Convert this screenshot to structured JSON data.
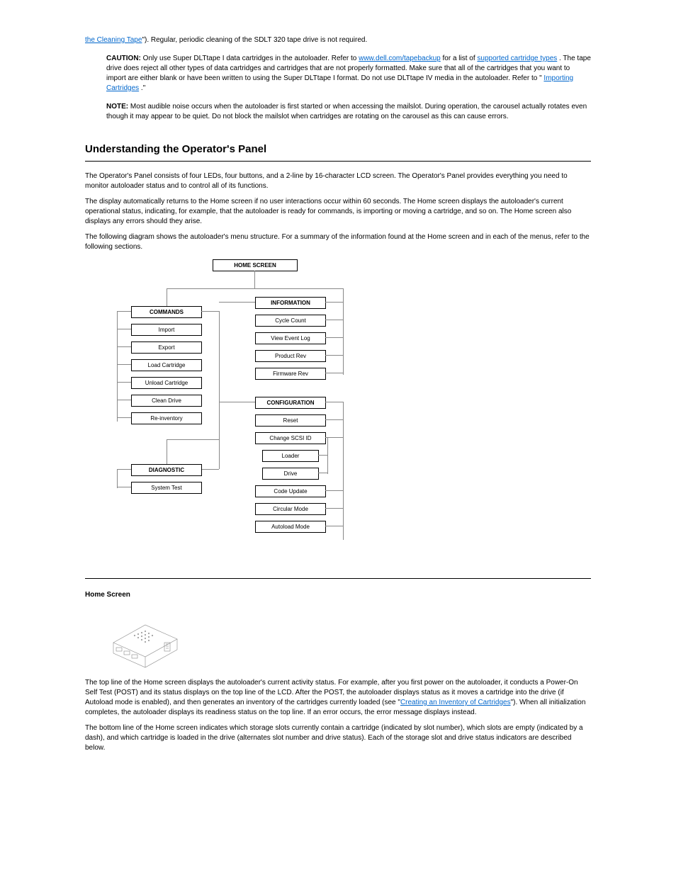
{
  "intro": {
    "line1_pre": "the Cleaning Tape",
    "line1_post": "\"). Regular, periodic cleaning of the SDLT 320 tape drive is not required."
  },
  "caution": {
    "label": "CAUTION:",
    "text_pre": "Only use Super DLTtape I data cartridges in the autoloader. Refer to ",
    "link1": "www.dell.com/tapebackup",
    "mid1": " for a list of ",
    "link2": "supported cartridge types",
    "mid2": ". The tape drive does reject all other types of data cartridges and cartridges that are not properly formatted. Make sure that all of the cartridges that you want to import are either blank or have been written to using the Super DLTtape I format. Do not use DLTtape IV media in the autoloader. Refer to \"",
    "link3": "Importing Cartridges",
    "close": ".\""
  },
  "note": {
    "label": "NOTE:",
    "text": "Most audible noise occurs when the autoloader is first started or when accessing the mailslot. During operation, the carousel actually rotates even though it may appear to be quiet. Do not block the mailslot when cartridges are rotating on the carousel as this can cause errors."
  },
  "h1": "Understanding the Operator's Panel",
  "op_p1": "The Operator's Panel consists of four LEDs, four buttons, and a 2-line by 16-character LCD screen. The Operator's Panel provides everything you need to monitor autoloader status and to control all of its functions.",
  "op_p2": "The display automatically returns to the Home screen if no user interactions occur within 60 seconds. The Home screen displays the autoloader's current operational status, indicating, for example, that the autoloader is ready for commands, is importing or moving a cartridge, and so on. The Home screen also displays any errors should they arise.",
  "op_p3": "The following diagram shows the autoloader's menu structure. For a summary of the information found at the Home screen and in each of the menus, refer to the following sections.",
  "diagram": {
    "home": "HOME SCREEN",
    "commands": "COMMANDS",
    "commands_items": [
      "Import",
      "Export",
      "Load Cartridge",
      "Unload Cartridge",
      "Clean Drive",
      "Re-inventory"
    ],
    "diagnostic": "DIAGNOSTIC",
    "diagnostic_items": [
      "System Test"
    ],
    "information": "INFORMATION",
    "information_items": [
      "Cycle Count",
      "View Event Log",
      "Product Rev",
      "Firmware Rev"
    ],
    "configuration": "CONFIGURATION",
    "configuration_items": [
      "Reset",
      "Change SCSI ID",
      "Loader",
      "Drive",
      "Code Update",
      "Circular Mode",
      "Autoload Mode"
    ]
  },
  "h2": "Home Screen",
  "home_p1_pre": "The top line of the Home screen displays the autoloader's current activity status. For example, after you first power on the autoloader, it conducts a Power-On Self Test (POST) and its status displays on the top line of the LCD. After the POST, the autoloader displays status as it moves a cartridge into the drive (if Autoload mode is enabled), and then generates an inventory of the cartridges currently loaded (see \"",
  "home_p1_link": "Creating an Inventory of Cartridges",
  "home_p1_post": "\"). When all initialization completes, the autoloader displays its readiness status on the top line. If an error occurs, the error message displays instead.",
  "home_p2": "The bottom line of the Home screen indicates which storage slots currently contain a cartridge (indicated by slot number), which slots are empty (indicated by a dash), and which cartridge is loaded in the drive (alternates slot number and drive status). Each of the storage slot and drive status indicators are described below."
}
